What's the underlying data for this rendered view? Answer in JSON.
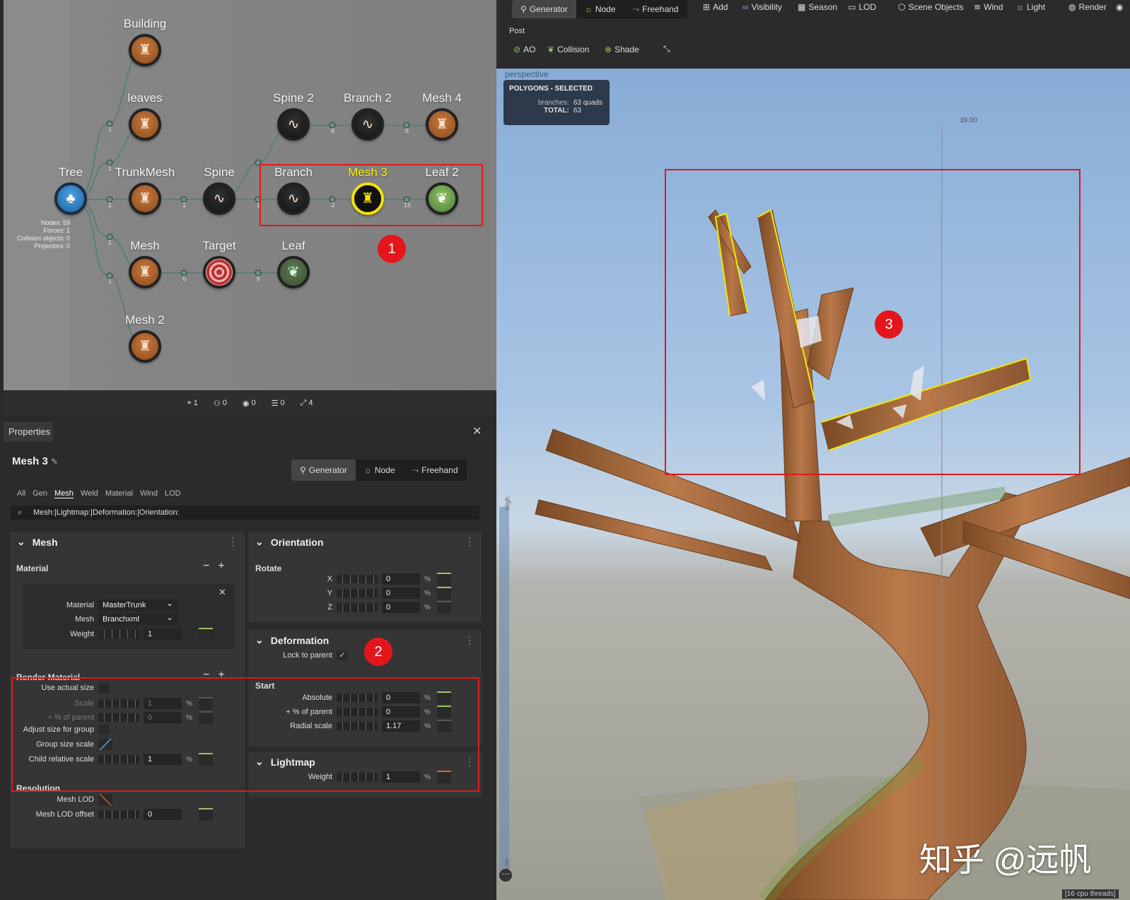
{
  "graph": {
    "nodes": [
      {
        "id": "building",
        "label": "Building",
        "style": "brown",
        "glyph": "♜"
      },
      {
        "id": "leaves",
        "label": "leaves",
        "style": "brown",
        "glyph": "♜"
      },
      {
        "id": "spine2",
        "label": "Spine 2",
        "style": "dark",
        "glyph": "∿"
      },
      {
        "id": "branch2",
        "label": "Branch 2",
        "style": "dark",
        "glyph": "∿"
      },
      {
        "id": "mesh4",
        "label": "Mesh 4",
        "style": "brown",
        "glyph": "♜"
      },
      {
        "id": "tree",
        "label": "Tree",
        "style": "blue",
        "glyph": "🌳"
      },
      {
        "id": "trunkmesh",
        "label": "TrunkMesh",
        "style": "brown",
        "glyph": "♜"
      },
      {
        "id": "spine",
        "label": "Spine",
        "style": "dark",
        "glyph": "∿"
      },
      {
        "id": "branch",
        "label": "Branch",
        "style": "dark",
        "glyph": "∿"
      },
      {
        "id": "mesh3",
        "label": "Mesh 3",
        "style": "yellow",
        "glyph": "♜"
      },
      {
        "id": "leaf2",
        "label": "Leaf 2",
        "style": "green",
        "glyph": "❦"
      },
      {
        "id": "mesh",
        "label": "Mesh",
        "style": "brown",
        "glyph": "♜"
      },
      {
        "id": "target",
        "label": "Target",
        "style": "target",
        "glyph": ""
      },
      {
        "id": "leaf",
        "label": "Leaf",
        "style": "greendk",
        "glyph": "❦"
      },
      {
        "id": "mesh2",
        "label": "Mesh 2",
        "style": "brown",
        "glyph": "♜"
      }
    ],
    "port_counts": [
      "1",
      "1",
      "1",
      "1",
      "1",
      "1",
      "8",
      "8",
      "1",
      "3",
      "15",
      "6",
      "6"
    ],
    "stats": [
      "Nodes: 59",
      "Forces: 1",
      "Collision objects: 0",
      "Projectors: 0"
    ],
    "bottom_bar": [
      {
        "icon": "tag-icon",
        "value": "1"
      },
      {
        "icon": "group-icon",
        "value": "0"
      },
      {
        "icon": "camera-icon",
        "value": "0"
      },
      {
        "icon": "list-icon",
        "value": "0"
      },
      {
        "icon": "link-icon",
        "value": "4"
      }
    ]
  },
  "annotations": {
    "one": "1",
    "two": "2",
    "three": "3"
  },
  "toolbar": {
    "generator": "Generator",
    "node": "Node",
    "freehand": "Freehand",
    "add": "Add",
    "visibility": "Visibility",
    "season": "Season",
    "lod": "LOD",
    "scene_objects": "Scene Objects",
    "wind": "Wind",
    "light": "Light",
    "render": "Render",
    "post_label": "Post",
    "ao": "AO",
    "collision": "Collision",
    "shade": "Shade"
  },
  "viewport": {
    "mode": "perspective",
    "info_title": "POLYGONS - SELECTED",
    "branches_label": "branches:",
    "branches_value": "63 quads",
    "total_label": "TOTAL:",
    "total_value": "63",
    "ruler_value": "39.00",
    "high_label": "High",
    "low_label": "Low",
    "cpu": "[16 cpu threads]",
    "watermark": "知乎 @远帆"
  },
  "properties": {
    "tab": "Properties",
    "title": "Mesh 3",
    "seg": {
      "generator": "Generator",
      "node": "Node",
      "freehand": "Freehand"
    },
    "filters": [
      "All",
      "Gen",
      "Mesh",
      "Weld",
      "Material",
      "Wind",
      "LOD"
    ],
    "search": "Mesh:|Lightmap:|Deformation:|Orientation:",
    "mesh_panel": {
      "title": "Mesh",
      "material_section": "Material",
      "material_label": "Material",
      "material_value": "MasterTrunk",
      "mesh_label": "Mesh",
      "mesh_value": "Branchxml",
      "weight_label": "Weight",
      "weight_value": "1",
      "render_material": "Render Material",
      "use_actual_size": "Use actual size",
      "scale_label": "Scale",
      "scale_value": "1",
      "pct_parent_label": "+ % of parent",
      "pct_parent_value": "0",
      "adjust_size": "Adjust size for group",
      "group_size_scale": "Group size scale",
      "child_relative": "Child relative scale",
      "child_relative_value": "1",
      "resolution": "Resolution",
      "mesh_lod": "Mesh LOD",
      "mesh_lod_offset": "Mesh LOD offset",
      "mesh_lod_offset_value": "0"
    },
    "orientation": {
      "title": "Orientation",
      "rotate": "Rotate",
      "x_label": "X",
      "x": "0",
      "y_label": "Y",
      "y": "0",
      "z_label": "Z",
      "z": "0"
    },
    "deformation": {
      "title": "Deformation",
      "lock": "Lock to parent",
      "start": "Start",
      "absolute": "Absolute",
      "absolute_value": "0",
      "pct_parent": "+ % of parent",
      "pct_parent_value": "0",
      "radial": "Radial scale",
      "radial_value": "1.17"
    },
    "lightmap": {
      "title": "Lightmap",
      "weight": "Weight",
      "weight_value": "1"
    }
  }
}
